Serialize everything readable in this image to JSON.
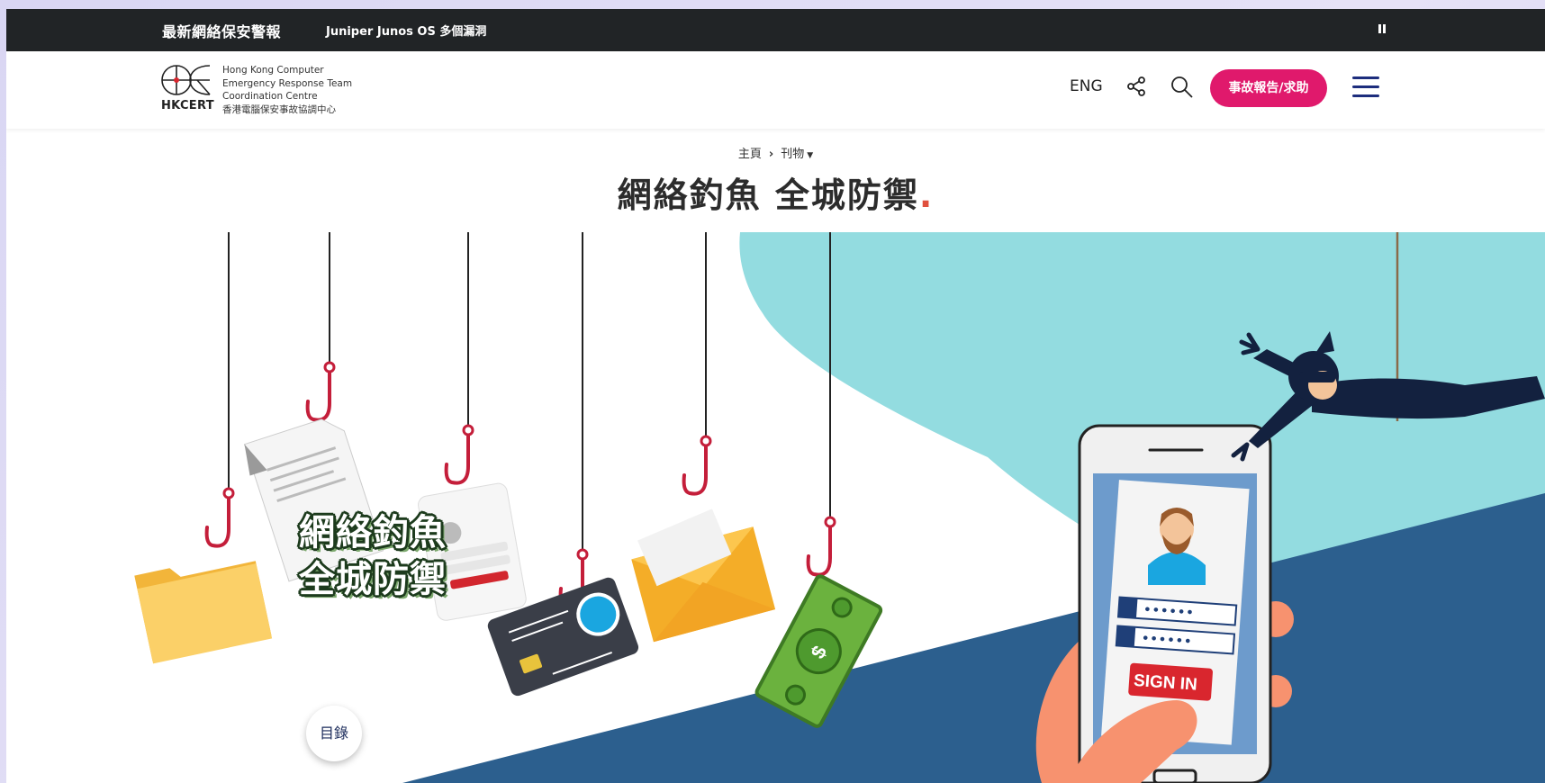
{
  "alert_bar": {
    "title": "最新網絡保安警報",
    "ticker": "Juniper Junos OS 多個漏洞"
  },
  "header": {
    "logo": {
      "abbr": "HKCERT",
      "name_lines": [
        "Hong Kong Computer",
        "Emergency Response Team",
        "Coordination Centre",
        "香港電腦保安事故協調中心"
      ]
    },
    "lang_label": "ENG",
    "report_button": "事故報告/求助"
  },
  "breadcrumb": {
    "home": "主頁",
    "current": "刊物"
  },
  "page": {
    "title": "網絡釣魚 全城防禦",
    "title_dot": "."
  },
  "hero": {
    "line1": "網絡釣魚",
    "line2": "全城防禦",
    "sign_in": "SIGN IN",
    "password_dots": "••••••"
  },
  "toc_button": "目錄",
  "colors": {
    "alert_bg": "#212426",
    "accent_pink": "#e0196c",
    "menu_blue": "#1d2d7d",
    "hero_teal": "#93dce0",
    "hero_navy": "#2c5f8e",
    "title_dot": "#e0503e"
  }
}
